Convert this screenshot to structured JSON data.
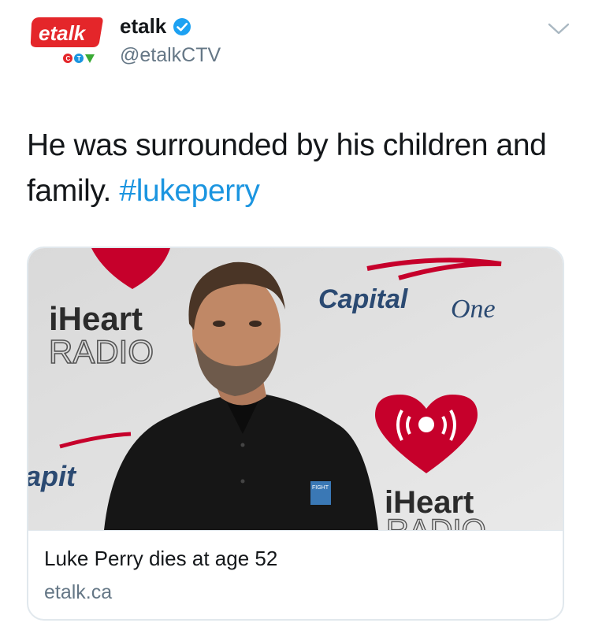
{
  "tweet": {
    "author": {
      "display_name": "etalk",
      "handle": "@etalkCTV",
      "verified": true,
      "avatar": {
        "logo_text": "etalk",
        "network_text": "CTV"
      }
    },
    "text": "He was surrounded by his children and family.",
    "hashtag": "#lukeperry",
    "menu_icon": "chevron-down-icon"
  },
  "card": {
    "title": "Luke Perry dies at age 52",
    "domain": "etalk.ca",
    "image": {
      "backdrop_texts": {
        "iheart_top": "iHeart",
        "radio_top": "RADIO",
        "capital": "Capital",
        "one": "One",
        "capital_left": "apit",
        "iheart_bottom": "iHeart",
        "radio_bottom": "RADIO",
        "shirt_badge": "FIGHT"
      }
    }
  },
  "colors": {
    "link": "#1b95e0",
    "text": "#14171a",
    "secondary": "#657786",
    "verified": "#1da1f2",
    "iheart_red": "#c6002b",
    "etalk_red": "#e4262a"
  }
}
